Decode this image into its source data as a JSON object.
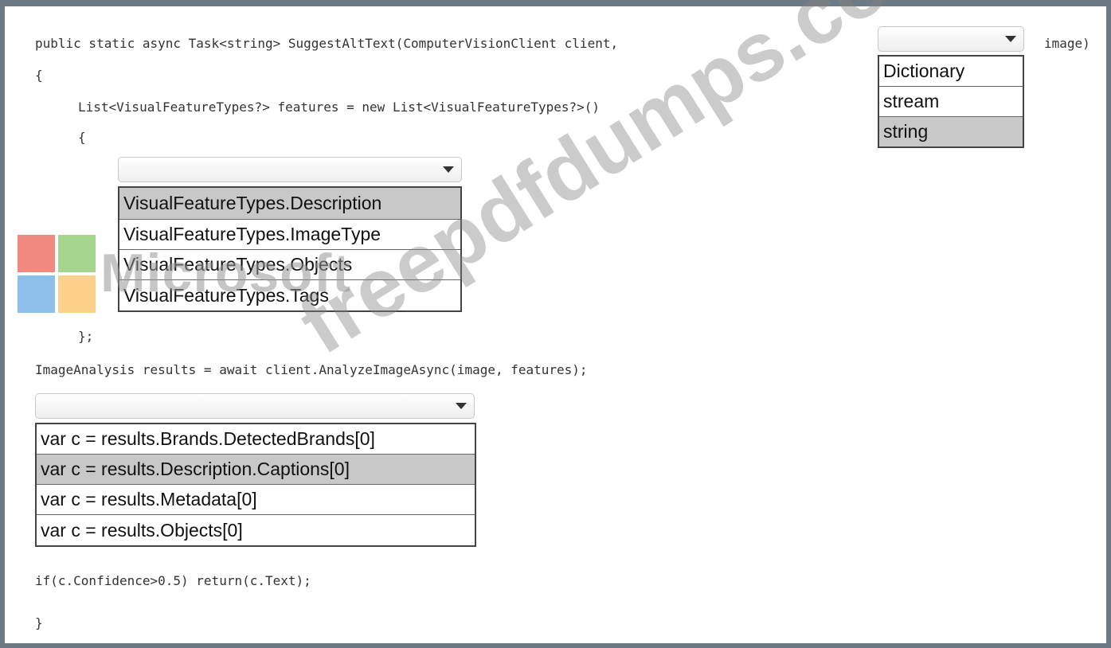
{
  "code": {
    "line_signature": "public static async Task<string> SuggestAltText(ComputerVisionClient client,",
    "line_signature_end": "image)",
    "line_open_brace": "{",
    "line_features": "List<VisualFeatureTypes?> features = new List<VisualFeatureTypes?>()",
    "line_init_open": "{",
    "line_init_close": "};",
    "line_analyze": "ImageAnalysis results = await client.AnalyzeImageAsync(image, features);",
    "line_if": "if(c.Confidence>0.5) return(c.Text);",
    "line_close_brace": "}"
  },
  "dropdowns": {
    "param_type": {
      "selected": "",
      "options": [
        "Dictionary",
        "stream",
        "string"
      ],
      "highlighted": "string"
    },
    "visual_features": {
      "selected": "",
      "options": [
        "VisualFeatureTypes.Description",
        "VisualFeatureTypes.ImageType",
        "VisualFeatureTypes.Objects",
        "VisualFeatureTypes.Tags"
      ],
      "highlighted": "VisualFeatureTypes.Description"
    },
    "result_var": {
      "selected": "",
      "options": [
        "var c = results.Brands.DetectedBrands[0]",
        "var c = results.Description.Captions[0]",
        "var c = results.Metadata[0]",
        "var c = results.Objects[0]"
      ],
      "highlighted": "var c = results.Description.Captions[0]"
    }
  },
  "watermarks": {
    "brand_text": "Microsoft",
    "site_text": "freepdfdumps.com"
  },
  "colors": {
    "logo_red": "#f08a80",
    "logo_green": "#a6d58e",
    "logo_blue": "#8cc0ea",
    "logo_yellow": "#fbd18c",
    "highlight": "#c8c8c8",
    "frame_border": "#6d7a86"
  }
}
